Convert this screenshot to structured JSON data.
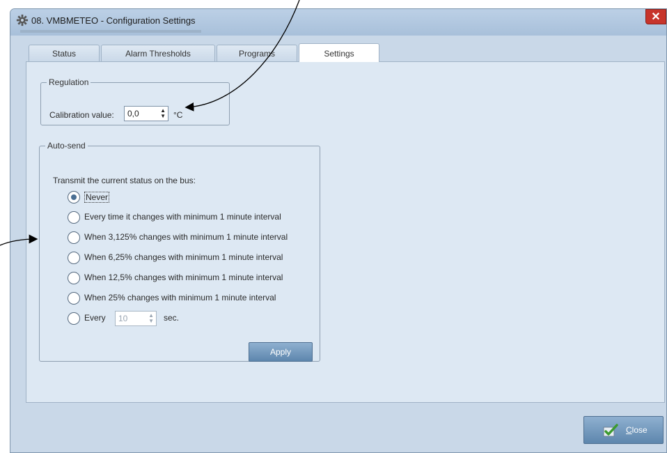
{
  "window": {
    "title": "08. VMBMETEO - Configuration Settings",
    "close_glyph": "✕"
  },
  "tabs": [
    {
      "label": "Status"
    },
    {
      "label": "Alarm Thresholds"
    },
    {
      "label": "Programs"
    },
    {
      "label": "Settings",
      "active": true
    }
  ],
  "regulation": {
    "legend": "Regulation",
    "calibration_label": "Calibration value:",
    "calibration_value": "0,0",
    "unit": "°C"
  },
  "autosend": {
    "legend": "Auto-send",
    "prompt": "Transmit the current status on the bus:",
    "options": [
      {
        "label": "Never",
        "selected": true
      },
      {
        "label": "Every time it changes with minimum 1 minute interval",
        "selected": false
      },
      {
        "label": "When 3,125% changes with minimum 1 minute interval",
        "selected": false
      },
      {
        "label": "When 6,25% changes with minimum 1 minute interval",
        "selected": false
      },
      {
        "label": "When 12,5% changes with minimum 1 minute interval",
        "selected": false
      },
      {
        "label": "When 25% changes with minimum 1 minute interval",
        "selected": false
      }
    ],
    "every": {
      "label": "Every",
      "value": "10",
      "unit": "sec.",
      "selected": false
    },
    "apply_label": "Apply"
  },
  "footer": {
    "close_label": "Close"
  },
  "colors": {
    "accent": "#5d86ad",
    "panel": "#dde8f3",
    "frame": "#c9d8e8",
    "close_red": "#c7342b"
  }
}
